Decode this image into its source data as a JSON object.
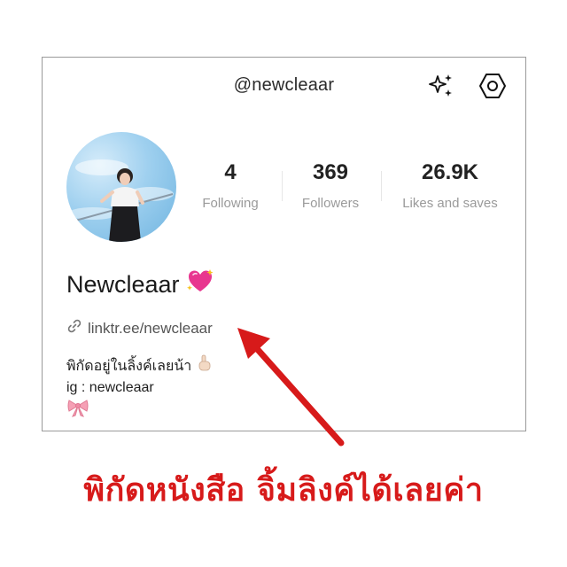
{
  "header": {
    "handle": "@newcleaar",
    "sparkle_icon": "sparkle-icon",
    "settings_icon": "settings-hexagon-icon"
  },
  "profile": {
    "avatar": "avatar-photo",
    "display_name": "Newcleaar",
    "name_emoji": "sparkling-heart-icon",
    "link_icon": "link-icon",
    "link": "linktr.ee/newcleaar",
    "bio_line1": "พิกัดอยู่ในลิ้งค์เลยน้า",
    "bio_line1_emoji": "pointing-up-icon",
    "bio_line2": "ig : newcleaar",
    "bio_line3_emoji": "ribbon-icon"
  },
  "stats": [
    {
      "value": "4",
      "label": "Following"
    },
    {
      "value": "369",
      "label": "Followers"
    },
    {
      "value": "26.9K",
      "label": "Likes and saves"
    }
  ],
  "overlay": {
    "caption": "พิกัดหนังสือ จิ้มลิงค์ได้เลยค่า",
    "accent_color": "#d71a1a",
    "arrow_icon": "red-arrow"
  }
}
